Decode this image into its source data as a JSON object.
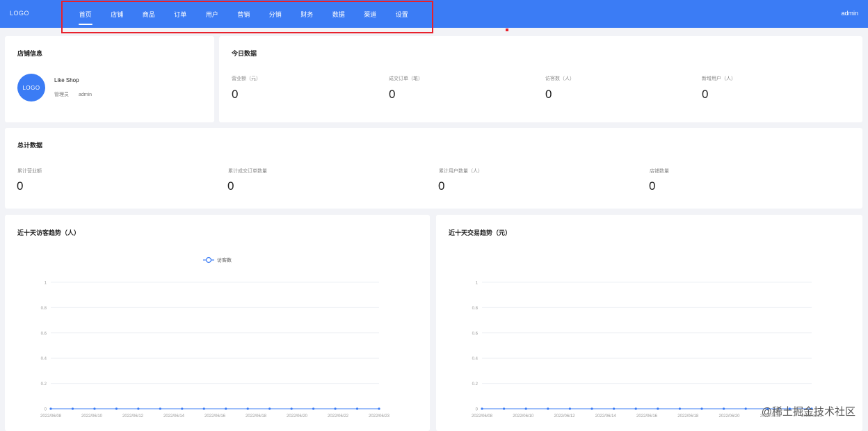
{
  "header": {
    "logo": "LOGO",
    "nav": [
      {
        "label": "首页",
        "active": true
      },
      {
        "label": "店铺"
      },
      {
        "label": "商品"
      },
      {
        "label": "订单"
      },
      {
        "label": "用户"
      },
      {
        "label": "营销"
      },
      {
        "label": "分销"
      },
      {
        "label": "财务"
      },
      {
        "label": "数据"
      },
      {
        "label": "渠道"
      },
      {
        "label": "设置"
      }
    ],
    "user_menu": "admin"
  },
  "shop_info": {
    "title": "店铺信息",
    "avatar": "LOGO",
    "name": "Like Shop",
    "role_label": "管理员",
    "role_value": "admin"
  },
  "today": {
    "title": "今日数据",
    "stats": [
      {
        "label": "营业额（元）",
        "value": "0"
      },
      {
        "label": "成交订单（笔）",
        "value": "0"
      },
      {
        "label": "访客数（人）",
        "value": "0"
      },
      {
        "label": "新增用户（人）",
        "value": "0"
      }
    ]
  },
  "totals": {
    "title": "总计数据",
    "stats": [
      {
        "label": "累计营业额",
        "value": "0"
      },
      {
        "label": "累计成交订单数量",
        "value": "0"
      },
      {
        "label": "累计用户数量（人）",
        "value": "0"
      },
      {
        "label": "店铺数量",
        "value": "0"
      }
    ]
  },
  "chart_data": [
    {
      "type": "line",
      "title": "近十天访客趋势（人）",
      "legend": [
        "访客数"
      ],
      "x": [
        "2022/06/08",
        "2022/06/09",
        "2022/06/10",
        "2022/06/11",
        "2022/06/12",
        "2022/06/13",
        "2022/06/14",
        "2022/06/15",
        "2022/06/16",
        "2022/06/17",
        "2022/06/18",
        "2022/06/19",
        "2022/06/20",
        "2022/06/21",
        "2022/06/22",
        "2022/06/23"
      ],
      "x_tick_labels": [
        "2022/06/08",
        "2022/06/10",
        "2022/06/12",
        "2022/06/14",
        "2022/06/16",
        "2022/06/18",
        "2022/06/20",
        "2022/06/22",
        "2022/06/23"
      ],
      "series": [
        {
          "name": "访客数",
          "values": [
            0,
            0,
            0,
            0,
            0,
            0,
            0,
            0,
            0,
            0,
            0,
            0,
            0,
            0,
            0,
            0
          ]
        }
      ],
      "yticks": [
        "0",
        "0.2",
        "0.4",
        "0.6",
        "0.8",
        "1"
      ],
      "ylim": [
        0,
        1
      ],
      "color": "#3b7cf5"
    },
    {
      "type": "line",
      "title": "近十天交易趋势（元）",
      "legend": [],
      "x": [
        "2022/06/08",
        "2022/06/09",
        "2022/06/10",
        "2022/06/11",
        "2022/06/12",
        "2022/06/13",
        "2022/06/14",
        "2022/06/15",
        "2022/06/16",
        "2022/06/17",
        "2022/06/18",
        "2022/06/19",
        "2022/06/20",
        "2022/06/21",
        "2022/06/22",
        "2022/06/23"
      ],
      "x_tick_labels": [
        "2022/06/08",
        "2022/06/10",
        "2022/06/12",
        "2022/06/14",
        "2022/06/16",
        "2022/06/18",
        "2022/06/20",
        "2022/06/22",
        "2022/06/23"
      ],
      "series": [
        {
          "values": [
            0,
            0,
            0,
            0,
            0,
            0,
            0,
            0,
            0,
            0,
            0,
            0,
            0,
            0,
            0,
            0
          ]
        }
      ],
      "yticks": [
        "0",
        "0.2",
        "0.4",
        "0.6",
        "0.8",
        "1"
      ],
      "ylim": [
        0,
        1
      ],
      "color": "#3b7cf5"
    }
  ],
  "watermark": "@稀土掘金技术社区"
}
